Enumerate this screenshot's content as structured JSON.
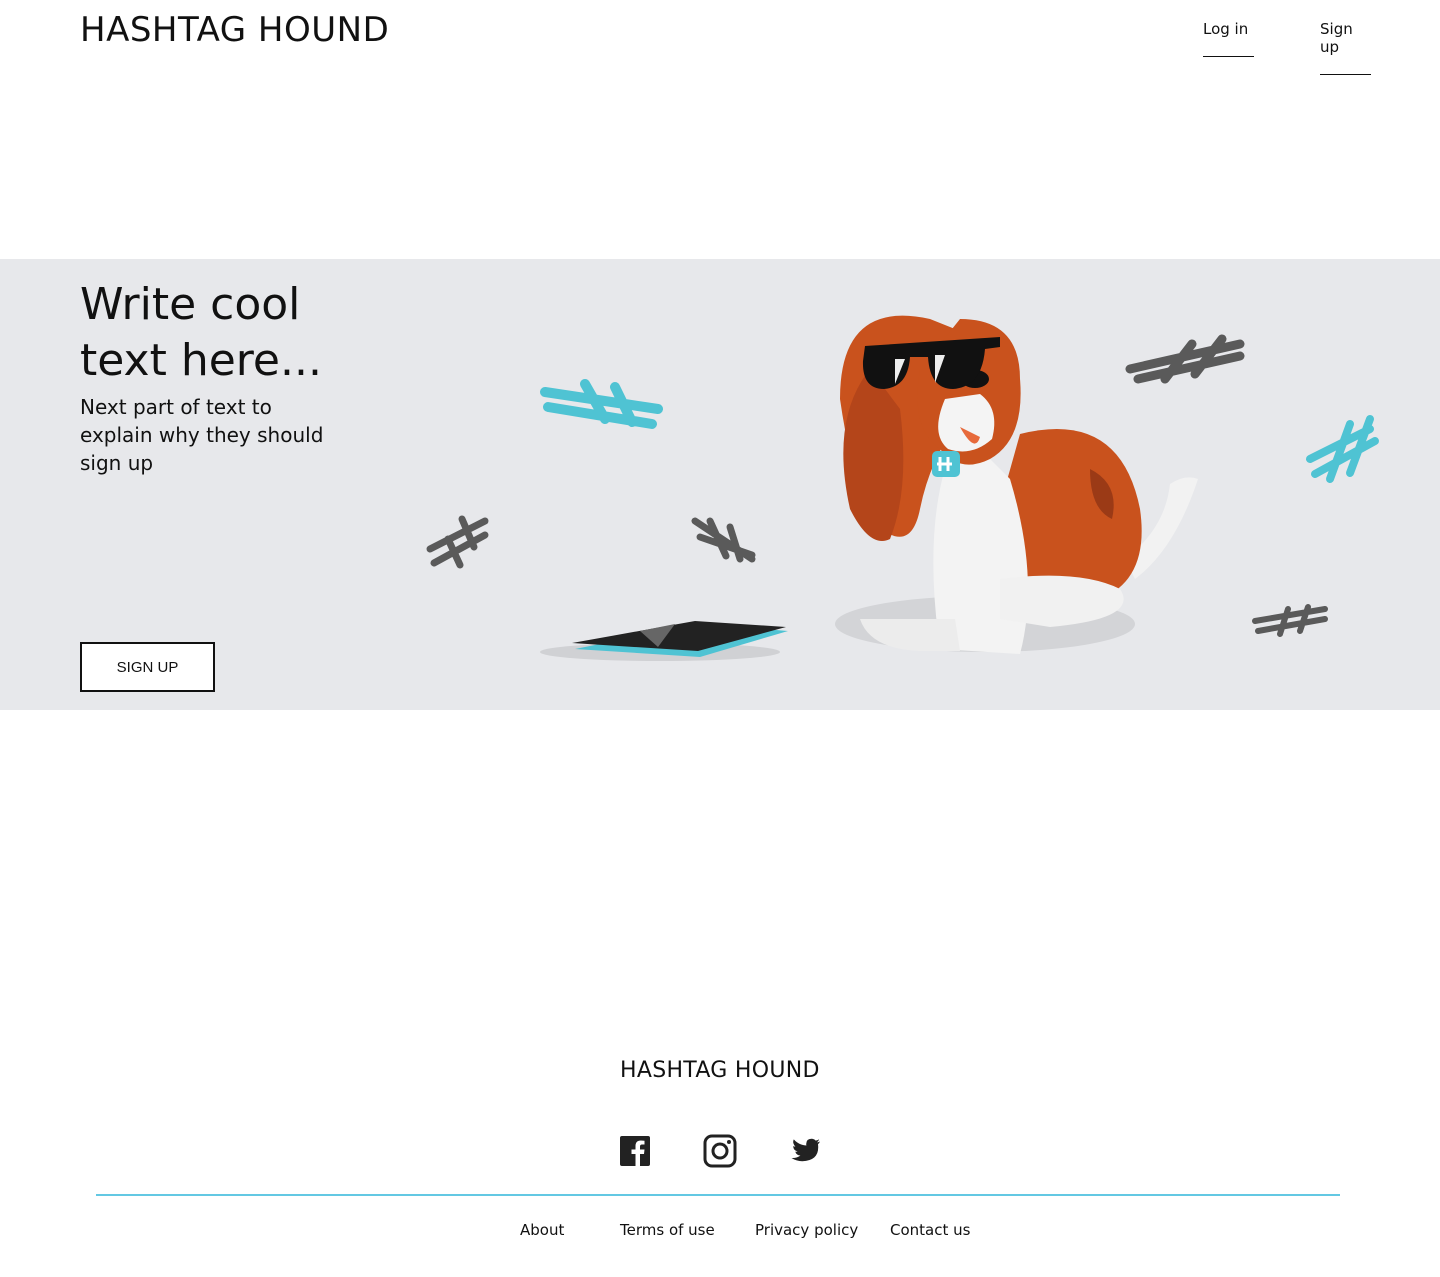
{
  "header": {
    "logo": "HASHTAG HOUND",
    "nav": {
      "login": "Log in",
      "signup": "Sign up"
    }
  },
  "hero": {
    "title": "Write cool text here...",
    "subtitle": "Next part of text to explain why they should sign up",
    "cta_label": "SIGN UP",
    "illustration": "basset-hound-with-sunglasses-and-hashtags",
    "colors": {
      "background": "#e7e8eb",
      "accent": "#4fc3d3",
      "dark": "#555555"
    }
  },
  "footer": {
    "logo": "HASHTAG HOUND",
    "social_icons": [
      "facebook-icon",
      "instagram-icon",
      "twitter-icon"
    ],
    "divider_color": "#63c8e3",
    "links": {
      "about": "About",
      "terms": "Terms of use",
      "privacy": "Privacy policy",
      "contact": "Contact us"
    }
  }
}
